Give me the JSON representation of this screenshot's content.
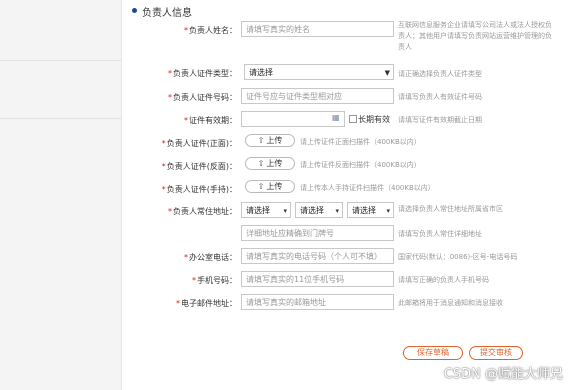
{
  "section": {
    "title": "负责人信息"
  },
  "fields": {
    "name": {
      "label": "负责人姓名：",
      "placeholder": "请填写真实的姓名",
      "hint": "互联网信息服务企业请填写公司法人或法人授权负责人；其他用户请填写负责网站运营维护管理的负责人"
    },
    "id_type": {
      "label": "负责人证件类型：",
      "value": "请选择",
      "hint": "请正确选择负责人证件类型"
    },
    "id_number": {
      "label": "负责人证件号码：",
      "placeholder": "证件号应与证件类型相对应",
      "hint": "请填写负责人有效证件号码"
    },
    "validity": {
      "label": "证件有效期：",
      "value": "",
      "long_term_label": "长期有效",
      "hint": "请填写证件有效期截止日期"
    },
    "id_front": {
      "label": "负责人证件(正面)：",
      "button": "上传",
      "hint": "请上传证件正面扫描件（400KB以内）"
    },
    "id_back": {
      "label": "负责人证件(反面)：",
      "button": "上传",
      "hint": "请上传证件反面扫描件（400KB以内）"
    },
    "id_hold": {
      "label": "负责人证件(手持)：",
      "button": "上传",
      "hint": "请上传本人手持证件扫描件（400KB以内）"
    },
    "address": {
      "label": "负责人常住地址：",
      "selects": [
        "请选择",
        "请选择",
        "请选择"
      ],
      "hint": "请选择负责人常住地址所属省市区",
      "detail_placeholder": "详细地址应精确到门牌号",
      "detail_hint": "请填写负责人常住详细地址"
    },
    "office_phone": {
      "label": "办公室电话：",
      "placeholder": "请填写真实的电话号码（个人可不填）",
      "hint": "国家代码(默认：0086)-区号-电话号码"
    },
    "mobile": {
      "label": "手机号码：",
      "placeholder": "请填写真实的11位手机号码",
      "hint": "请填写正确的负责人手机号码"
    },
    "email": {
      "label": "电子邮件地址：",
      "placeholder": "请填写真实的邮箱地址",
      "hint": "此邮箱将用于消息通知和消息接收"
    }
  },
  "actions": {
    "save": "保存草稿",
    "submit": "提交审核"
  },
  "watermark": "CSDN @赋能大师兄",
  "icons": {
    "upload": "upload-icon",
    "calendar": "calendar-icon",
    "dropdown": "chevron-down-icon"
  },
  "colors": {
    "required": "#e02020",
    "accent": "#e0632c",
    "section_dot": "#1a4a8a"
  }
}
